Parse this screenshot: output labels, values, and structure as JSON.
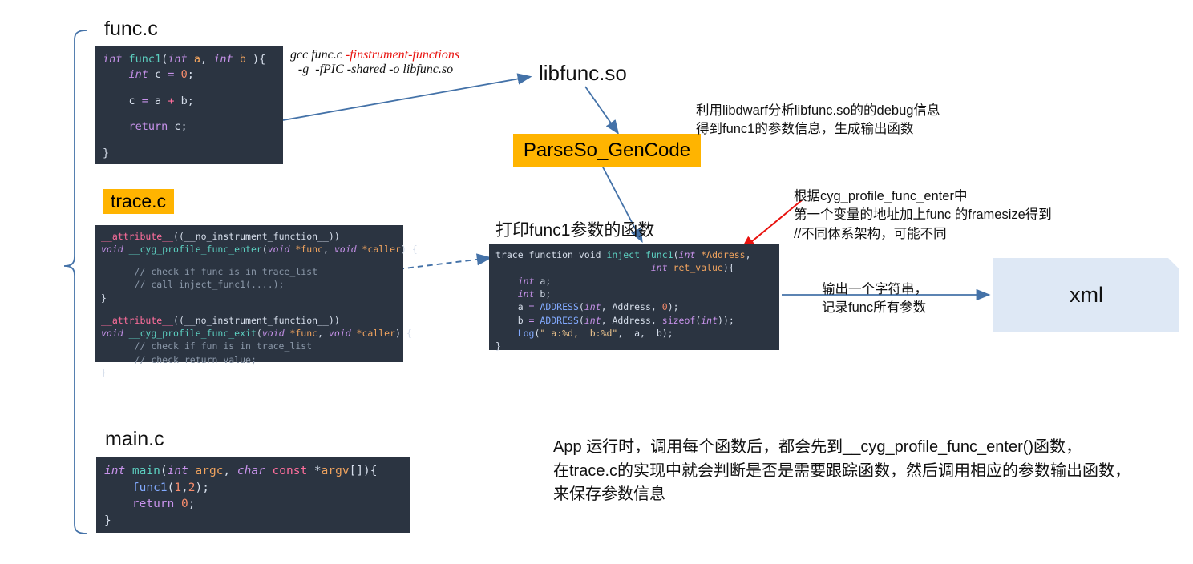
{
  "diagram": {
    "app_bracket_label": "App",
    "func_c": {
      "title": "func.c",
      "lines": [
        [
          {
            "t": "int ",
            "c": "kw"
          },
          {
            "t": "func1",
            "c": "fn"
          },
          {
            "t": "(",
            "c": "white"
          },
          {
            "t": "int ",
            "c": "kw"
          },
          {
            "t": "a",
            "c": "var"
          },
          {
            "t": ", ",
            "c": "white"
          },
          {
            "t": "int ",
            "c": "kw"
          },
          {
            "t": "b",
            "c": "var"
          },
          {
            "t": " ){",
            "c": "white"
          }
        ],
        [
          {
            "t": "    ",
            "c": "white"
          },
          {
            "t": "int ",
            "c": "kw"
          },
          {
            "t": "c ",
            "c": "white"
          },
          {
            "t": "= ",
            "c": "op"
          },
          {
            "t": "0",
            "c": "num"
          },
          {
            "t": ";",
            "c": "white"
          }
        ],
        [
          {
            "t": "",
            "c": "white"
          }
        ],
        [
          {
            "t": "    c ",
            "c": "white"
          },
          {
            "t": "= ",
            "c": "op"
          },
          {
            "t": "a ",
            "c": "white"
          },
          {
            "t": "+ ",
            "c": "pink"
          },
          {
            "t": "b;",
            "c": "white"
          }
        ],
        [
          {
            "t": "",
            "c": "white"
          }
        ],
        [
          {
            "t": "    ",
            "c": "white"
          },
          {
            "t": "return",
            "c": "op"
          },
          {
            "t": " c;",
            "c": "white"
          }
        ],
        [
          {
            "t": "",
            "c": "white"
          }
        ],
        [
          {
            "t": "}",
            "c": "white"
          }
        ]
      ]
    },
    "gcc_command": {
      "line1_pre": "gcc func.c ",
      "line1_flag": "-finstrument-functions",
      "line2": "-g  -fPIC -shared -o libfunc.so"
    },
    "libfunc_so_label": "libfunc.so",
    "parse_so_box_label": "ParseSo_GenCode",
    "parse_so_note": "利用libdwarf分析libfunc.so的的debug信息\n得到func1的参数信息，生成输出函数",
    "trace_c": {
      "title": "trace.c",
      "lines": [
        [
          {
            "t": "__attribute__",
            "c": "pink"
          },
          {
            "t": "((",
            "c": "white"
          },
          {
            "t": "__no_instrument_function__",
            "c": "white"
          },
          {
            "t": "))",
            "c": "white"
          }
        ],
        [
          {
            "t": "void ",
            "c": "kw"
          },
          {
            "t": "__cyg_profile_func_enter",
            "c": "fn"
          },
          {
            "t": "(",
            "c": "white"
          },
          {
            "t": "void ",
            "c": "kw"
          },
          {
            "t": "*func",
            "c": "var"
          },
          {
            "t": ", ",
            "c": "white"
          },
          {
            "t": "void ",
            "c": "kw"
          },
          {
            "t": "*caller",
            "c": "var"
          },
          {
            "t": ") {",
            "c": "white"
          }
        ],
        [
          {
            "t": "",
            "c": "white"
          }
        ],
        [
          {
            "t": "      ",
            "c": "white"
          },
          {
            "t": "// check if func is in trace_list",
            "c": "cm"
          }
        ],
        [
          {
            "t": "      ",
            "c": "white"
          },
          {
            "t": "// call inject_func1(....);",
            "c": "cm"
          }
        ],
        [
          {
            "t": "}",
            "c": "white"
          }
        ],
        [
          {
            "t": "",
            "c": "white"
          }
        ],
        [
          {
            "t": "__attribute__",
            "c": "pink"
          },
          {
            "t": "((",
            "c": "white"
          },
          {
            "t": "__no_instrument_function__",
            "c": "white"
          },
          {
            "t": "))",
            "c": "white"
          }
        ],
        [
          {
            "t": "void ",
            "c": "kw"
          },
          {
            "t": "__cyg_profile_func_exit",
            "c": "fn"
          },
          {
            "t": "(",
            "c": "white"
          },
          {
            "t": "void ",
            "c": "kw"
          },
          {
            "t": "*func",
            "c": "var"
          },
          {
            "t": ", ",
            "c": "white"
          },
          {
            "t": "void ",
            "c": "kw"
          },
          {
            "t": "*caller",
            "c": "var"
          },
          {
            "t": ") {",
            "c": "white"
          }
        ],
        [
          {
            "t": "      ",
            "c": "white"
          },
          {
            "t": "// check if fun is in trace_list",
            "c": "cm"
          }
        ],
        [
          {
            "t": "      ",
            "c": "white"
          },
          {
            "t": "// check return value;",
            "c": "cm"
          }
        ],
        [
          {
            "t": "}",
            "c": "white"
          }
        ]
      ]
    },
    "inject_title": "打印func1参数的函数",
    "inject_code": {
      "lines": [
        [
          {
            "t": "trace_function_void ",
            "c": "white"
          },
          {
            "t": "inject_func1",
            "c": "fn"
          },
          {
            "t": "(",
            "c": "white"
          },
          {
            "t": "int ",
            "c": "kw"
          },
          {
            "t": "*Address",
            "c": "var"
          },
          {
            "t": ",",
            "c": "white"
          }
        ],
        [
          {
            "t": "                            ",
            "c": "white"
          },
          {
            "t": "int ",
            "c": "kw"
          },
          {
            "t": "ret_value",
            "c": "var"
          },
          {
            "t": "){",
            "c": "white"
          }
        ],
        [
          {
            "t": "    ",
            "c": "white"
          },
          {
            "t": "int ",
            "c": "kw"
          },
          {
            "t": "a;",
            "c": "white"
          }
        ],
        [
          {
            "t": "    ",
            "c": "white"
          },
          {
            "t": "int ",
            "c": "kw"
          },
          {
            "t": "b;",
            "c": "white"
          }
        ],
        [
          {
            "t": "    a ",
            "c": "white"
          },
          {
            "t": "= ",
            "c": "op"
          },
          {
            "t": "ADDRESS",
            "c": "blue"
          },
          {
            "t": "(",
            "c": "white"
          },
          {
            "t": "int",
            "c": "kw"
          },
          {
            "t": ", Address, ",
            "c": "white"
          },
          {
            "t": "0",
            "c": "num"
          },
          {
            "t": ");",
            "c": "white"
          }
        ],
        [
          {
            "t": "    b ",
            "c": "white"
          },
          {
            "t": "= ",
            "c": "op"
          },
          {
            "t": "ADDRESS",
            "c": "blue"
          },
          {
            "t": "(",
            "c": "white"
          },
          {
            "t": "int",
            "c": "kw"
          },
          {
            "t": ", Address, ",
            "c": "white"
          },
          {
            "t": "sizeof",
            "c": "op"
          },
          {
            "t": "(",
            "c": "white"
          },
          {
            "t": "int",
            "c": "kw"
          },
          {
            "t": "));",
            "c": "white"
          }
        ],
        [
          {
            "t": "    ",
            "c": "white"
          },
          {
            "t": "Log",
            "c": "blue"
          },
          {
            "t": "(",
            "c": "white"
          },
          {
            "t": "\" a:%d,  b:%d\"",
            "c": "str"
          },
          {
            "t": ",  a,  b);",
            "c": "white"
          }
        ],
        [
          {
            "t": "}",
            "c": "white"
          }
        ]
      ]
    },
    "framesize_note": "根据cyg_profile_func_enter中\n第一个变量的地址加上func 的framesize得到\n//不同体系架构，可能不同",
    "xml_note": "输出一个字符串，\n记录func所有参数",
    "xml_box_label": "xml",
    "main_c": {
      "title": "main.c",
      "lines": [
        [
          {
            "t": "int ",
            "c": "kw"
          },
          {
            "t": "main",
            "c": "fn"
          },
          {
            "t": "(",
            "c": "white"
          },
          {
            "t": "int ",
            "c": "kw"
          },
          {
            "t": "argc",
            "c": "var"
          },
          {
            "t": ", ",
            "c": "white"
          },
          {
            "t": "char ",
            "c": "kw"
          },
          {
            "t": "const",
            "c": "pink"
          },
          {
            "t": " *",
            "c": "white"
          },
          {
            "t": "argv",
            "c": "var"
          },
          {
            "t": "[]){",
            "c": "white"
          }
        ],
        [
          {
            "t": "    ",
            "c": "white"
          },
          {
            "t": "func1",
            "c": "blue"
          },
          {
            "t": "(",
            "c": "white"
          },
          {
            "t": "1",
            "c": "num"
          },
          {
            "t": ",",
            "c": "white"
          },
          {
            "t": "2",
            "c": "num"
          },
          {
            "t": ");",
            "c": "white"
          }
        ],
        [
          {
            "t": "    ",
            "c": "white"
          },
          {
            "t": "return",
            "c": "op"
          },
          {
            "t": " ",
            "c": "white"
          },
          {
            "t": "0",
            "c": "num"
          },
          {
            "t": ";",
            "c": "white"
          }
        ],
        [
          {
            "t": "}",
            "c": "white"
          }
        ]
      ]
    },
    "bottom_note": "App 运行时，调用每个函数后，都会先到__cyg_profile_func_enter()函数，\n在trace.c的实现中就会判断是否是需要跟踪函数，然后调用相应的参数输出函数，\n来保存参数信息"
  },
  "colors": {
    "highlight": "#FFB400",
    "arrow_blue": "#4472A8",
    "arrow_red": "#E8120E",
    "code_bg": "#2b3441",
    "xml_bg": "#DEE8F5",
    "flag_red": "#E8120E"
  }
}
